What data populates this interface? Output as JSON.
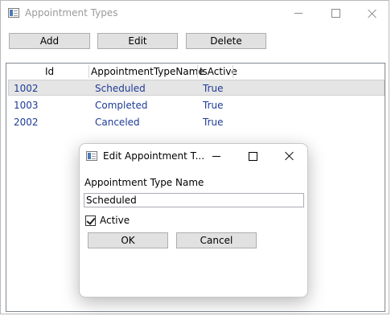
{
  "window": {
    "title": "Appointment Types",
    "controls": [
      "minimize-icon",
      "maximize-icon",
      "close-icon"
    ]
  },
  "toolbar": {
    "add_label": "Add",
    "edit_label": "Edit",
    "delete_label": "Delete"
  },
  "grid": {
    "columns": [
      "Id",
      "AppointmentTypeName",
      "IsActive"
    ],
    "rows": [
      {
        "id": "1002",
        "name": "Scheduled",
        "active": "True",
        "selected": true
      },
      {
        "id": "1003",
        "name": "Completed",
        "active": "True",
        "selected": false
      },
      {
        "id": "2002",
        "name": "Canceled",
        "active": "True",
        "selected": false
      }
    ]
  },
  "dialog": {
    "title": "Edit Appointment T...",
    "field_label": "Appointment Type Name",
    "field_value": "Scheduled",
    "active_label": "Active",
    "active_checked": true,
    "ok_label": "OK",
    "cancel_label": "Cancel"
  },
  "colors": {
    "cell_text": "#1e3b96",
    "button_bg": "#e1e1e1",
    "selected_row": "#e5e5e5"
  }
}
